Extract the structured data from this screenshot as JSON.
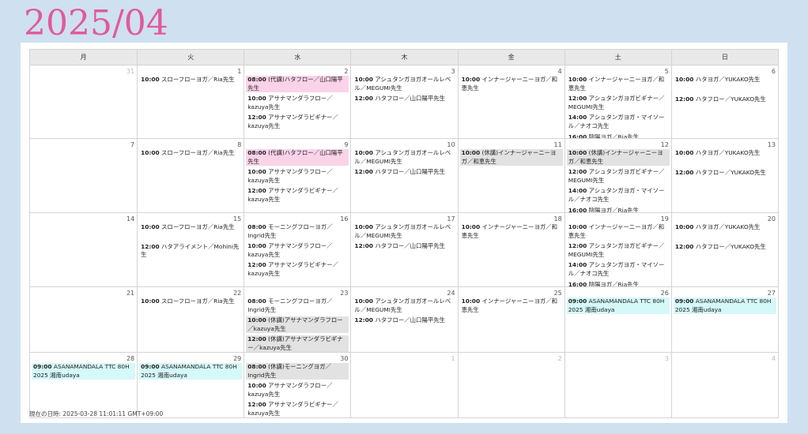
{
  "title": "2025/04",
  "weekdays": [
    "月",
    "火",
    "水",
    "木",
    "金",
    "土",
    "日"
  ],
  "weeks": [
    {
      "days": [
        {
          "num": "31",
          "dim": true,
          "events": []
        },
        {
          "num": "1",
          "events": [
            {
              "time": "10:00",
              "text": "スローフローヨガ／Ria先生"
            }
          ]
        },
        {
          "num": "2",
          "events": [
            {
              "time": "08:00",
              "text": "(代講)ハタフロー／山口陽平先生",
              "style": "pink"
            },
            {
              "time": "10:00",
              "text": "アサナマンダラフロー／kazuya先生"
            },
            {
              "time": "12:00",
              "text": "アサナマンダラビギナー／kazuya先生"
            }
          ]
        },
        {
          "num": "3",
          "events": [
            {
              "time": "10:00",
              "text": "アシュタンガヨガオールレベル／MEGUMI先生"
            },
            {
              "time": "12:00",
              "text": "ハタフロー／山口陽平先生"
            }
          ]
        },
        {
          "num": "4",
          "events": [
            {
              "time": "10:00",
              "text": "インナージャーニーヨガ／和恵先生"
            }
          ]
        },
        {
          "num": "5",
          "events": [
            {
              "time": "10:00",
              "text": "インナージャーニーヨガ／和恵先生"
            },
            {
              "time": "12:00",
              "text": "アシュタンガヨガビギナー／MEGUMI先生"
            },
            {
              "time": "14:00",
              "text": "アシュタンガヨガ・マイソール／ナオコ先生"
            },
            {
              "time": "16:00",
              "text": "陰陽ヨガ／Ria先生"
            }
          ]
        },
        {
          "num": "6",
          "events": [
            {
              "time": "10:00",
              "text": "ハタヨガ／YUKAKO先生"
            },
            {
              "blank": true
            },
            {
              "time": "12:00",
              "text": "ハタフロー／YUKAKO先生"
            }
          ]
        }
      ]
    },
    {
      "days": [
        {
          "num": "7",
          "events": []
        },
        {
          "num": "8",
          "events": [
            {
              "time": "10:00",
              "text": "スローフローヨガ／Ria先生"
            }
          ]
        },
        {
          "num": "9",
          "events": [
            {
              "time": "08:00",
              "text": "(代講)ハタフロー／山口陽平先生",
              "style": "pink"
            },
            {
              "time": "10:00",
              "text": "アサナマンダラフロー／kazuya先生"
            },
            {
              "time": "12:00",
              "text": "アサナマンダラビギナー／kazuya先生"
            }
          ]
        },
        {
          "num": "10",
          "events": [
            {
              "time": "10:00",
              "text": "アシュタンガヨガオールレベル／MEGUMI先生"
            },
            {
              "time": "12:00",
              "text": "ハタフロー／山口陽平先生"
            }
          ]
        },
        {
          "num": "11",
          "events": [
            {
              "time": "10:00",
              "text": "(休講)インナージャーニーヨガ／和恵先生",
              "style": "gray"
            }
          ]
        },
        {
          "num": "12",
          "events": [
            {
              "time": "10:00",
              "text": "(休講)インナージャーニーヨガ／和恵先生",
              "style": "gray"
            },
            {
              "time": "12:00",
              "text": "アシュタンガヨガビギナー／MEGUMI先生"
            },
            {
              "time": "14:00",
              "text": "アシュタンガヨガ・マイソール／ナオコ先生"
            },
            {
              "time": "16:00",
              "text": "陰陽ヨガ／Ria先生"
            }
          ]
        },
        {
          "num": "13",
          "events": [
            {
              "time": "10:00",
              "text": "ハタヨガ／YUKAKO先生"
            },
            {
              "blank": true
            },
            {
              "time": "12:00",
              "text": "ハタフロー／YUKAKO先生"
            }
          ]
        }
      ]
    },
    {
      "days": [
        {
          "num": "14",
          "events": []
        },
        {
          "num": "15",
          "events": [
            {
              "time": "10:00",
              "text": "スローフローヨガ／Ria先生"
            },
            {
              "blank": true
            },
            {
              "time": "12:00",
              "text": "ハタアライメント／Mohini先生"
            }
          ]
        },
        {
          "num": "16",
          "events": [
            {
              "time": "08:00",
              "text": "モーニングフローヨガ／Ingrid先生"
            },
            {
              "time": "10:00",
              "text": "アサナマンダラフロー／kazuya先生"
            },
            {
              "time": "12:00",
              "text": "アサナマンダラビギナー／kazuya先生"
            }
          ]
        },
        {
          "num": "17",
          "events": [
            {
              "time": "10:00",
              "text": "アシュタンガヨガオールレベル／MEGUMI先生"
            },
            {
              "time": "12:00",
              "text": "ハタフロー／山口陽平先生"
            }
          ]
        },
        {
          "num": "18",
          "events": [
            {
              "time": "10:00",
              "text": "インナージャーニーヨガ／和恵先生"
            }
          ]
        },
        {
          "num": "19",
          "events": [
            {
              "time": "10:00",
              "text": "インナージャーニーヨガ／和恵先生"
            },
            {
              "time": "12:00",
              "text": "アシュタンガヨガビギナー／MEGUMI先生"
            },
            {
              "time": "14:00",
              "text": "アシュタンガヨガ・マイソール／ナオコ先生"
            },
            {
              "time": "16:00",
              "text": "陰陽ヨガ／Ria先生"
            }
          ]
        },
        {
          "num": "20",
          "events": [
            {
              "time": "10:00",
              "text": "ハタヨガ／YUKAKO先生"
            },
            {
              "blank": true
            },
            {
              "time": "12:00",
              "text": "ハタフロー／YUKAKO先生"
            }
          ]
        }
      ]
    },
    {
      "days": [
        {
          "num": "21",
          "events": []
        },
        {
          "num": "22",
          "events": [
            {
              "time": "10:00",
              "text": "スローフローヨガ／Ria先生"
            }
          ]
        },
        {
          "num": "23",
          "events": [
            {
              "time": "08:00",
              "text": "モーニングフローヨガ／Ingrid先生"
            },
            {
              "time": "10:00",
              "text": "(休講)アサナマンダラフロー／kazuya先生",
              "style": "gray"
            },
            {
              "time": "12:00",
              "text": "(休講)アサナマンダラビギナー／kazuya先生",
              "style": "gray"
            }
          ]
        },
        {
          "num": "24",
          "events": [
            {
              "time": "10:00",
              "text": "アシュタンガヨガオールレベル／MEGUMI先生"
            },
            {
              "time": "12:00",
              "text": "ハタフロー／山口陽平先生"
            }
          ]
        },
        {
          "num": "25",
          "events": [
            {
              "time": "10:00",
              "text": "インナージャーニーヨガ／和恵先生"
            }
          ]
        },
        {
          "num": "26",
          "events": [
            {
              "time": "09:00",
              "text": "ASANAMANDALA TTC 80H 2025 湘南udaya",
              "style": "cyan"
            }
          ]
        },
        {
          "num": "27",
          "events": [
            {
              "time": "09:00",
              "text": "ASANAMANDALA TTC 80H 2025 湘南udaya",
              "style": "cyan"
            }
          ]
        }
      ]
    },
    {
      "days": [
        {
          "num": "28",
          "events": [
            {
              "time": "09:00",
              "text": "ASANAMANDALA TTC 80H 2025 湘南udaya",
              "style": "cyan"
            }
          ]
        },
        {
          "num": "29",
          "events": [
            {
              "time": "09:00",
              "text": "ASANAMANDALA TTC 80H 2025 湘南udaya",
              "style": "cyan"
            }
          ]
        },
        {
          "num": "30",
          "events": [
            {
              "time": "08:00",
              "text": "(休講)モーニングヨガ／Ingrid先生",
              "style": "gray"
            },
            {
              "time": "10:00",
              "text": "アサナマンダラフロー／kazuya先生"
            },
            {
              "time": "12:00",
              "text": "アサナマンダラビギナー／kazuya先生"
            }
          ]
        },
        {
          "num": "1",
          "dim": true,
          "events": []
        },
        {
          "num": "2",
          "dim": true,
          "events": []
        },
        {
          "num": "3",
          "dim": true,
          "events": []
        },
        {
          "num": "4",
          "dim": true,
          "events": []
        }
      ]
    }
  ],
  "footer": "現在の日時: 2025-03-28 11:01:11 GMT+09:00"
}
